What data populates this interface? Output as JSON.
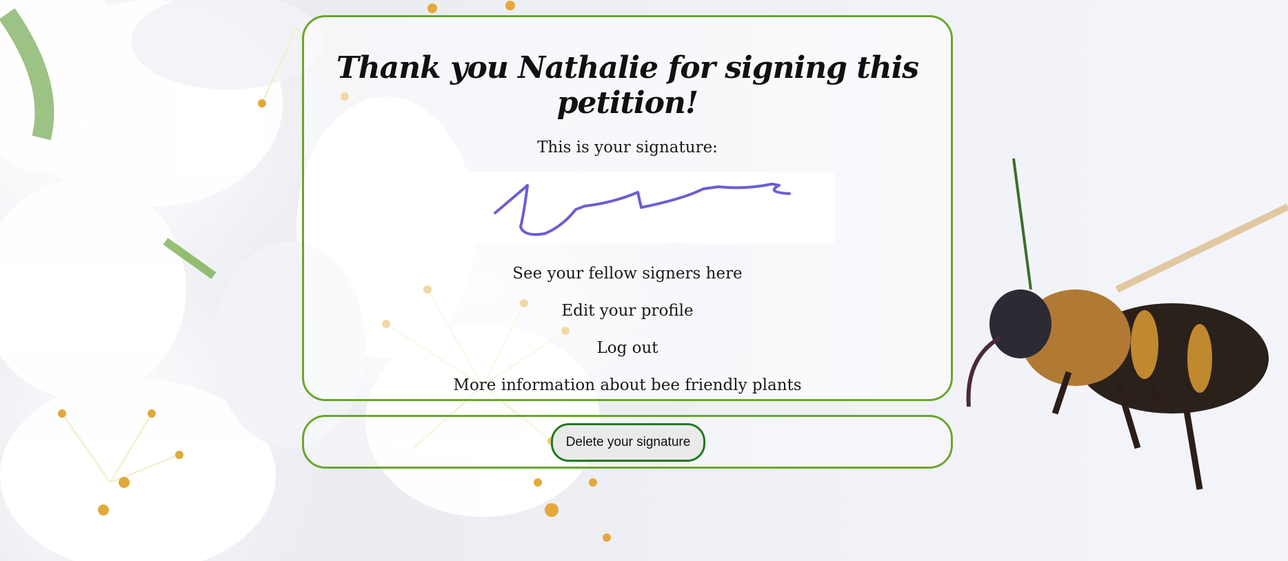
{
  "page": {
    "title": "Thank you Nathalie for signing this petition!",
    "signature_label": "This is your signature:",
    "links": [
      "See your fellow signers here",
      "Edit your profile",
      "Log out",
      "More information about bee friendly plants"
    ],
    "delete_button_label": "Delete your signature"
  },
  "colors": {
    "card_border": "#6aa62a",
    "button_border": "#1f7a1f",
    "signature_stroke": "#6a5fd0"
  }
}
